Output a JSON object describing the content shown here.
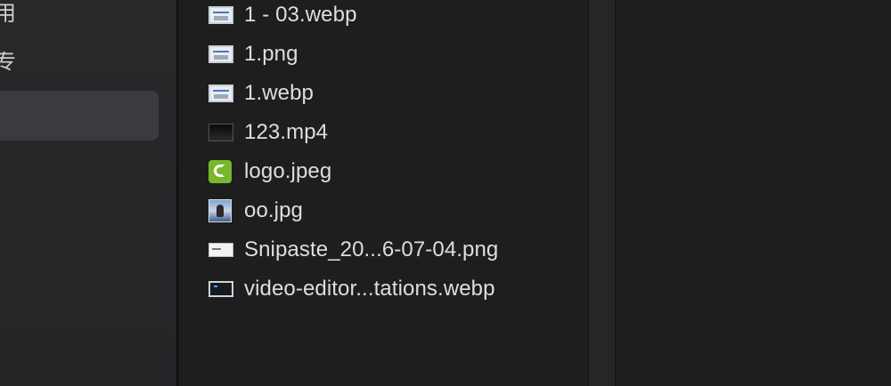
{
  "sidebar": {
    "fragments": [
      "用",
      "专"
    ]
  },
  "files": [
    {
      "name": "1 - 03.webp",
      "icon": "image-thumbnail-icon",
      "kind": "img"
    },
    {
      "name": "1.png",
      "icon": "image-thumbnail-icon",
      "kind": "img"
    },
    {
      "name": "1.webp",
      "icon": "image-thumbnail-icon",
      "kind": "img"
    },
    {
      "name": "123.mp4",
      "icon": "video-thumbnail-icon",
      "kind": "video"
    },
    {
      "name": "logo.jpeg",
      "icon": "logo-thumbnail-icon",
      "kind": "logo"
    },
    {
      "name": "oo.jpg",
      "icon": "photo-thumbnail-icon",
      "kind": "photo"
    },
    {
      "name": "Snipaste_20...6-07-04.png",
      "icon": "screenshot-thumbnail-icon",
      "kind": "shot"
    },
    {
      "name": "video-editor...tations.webp",
      "icon": "dark-image-thumbnail-icon",
      "kind": "dark"
    }
  ]
}
